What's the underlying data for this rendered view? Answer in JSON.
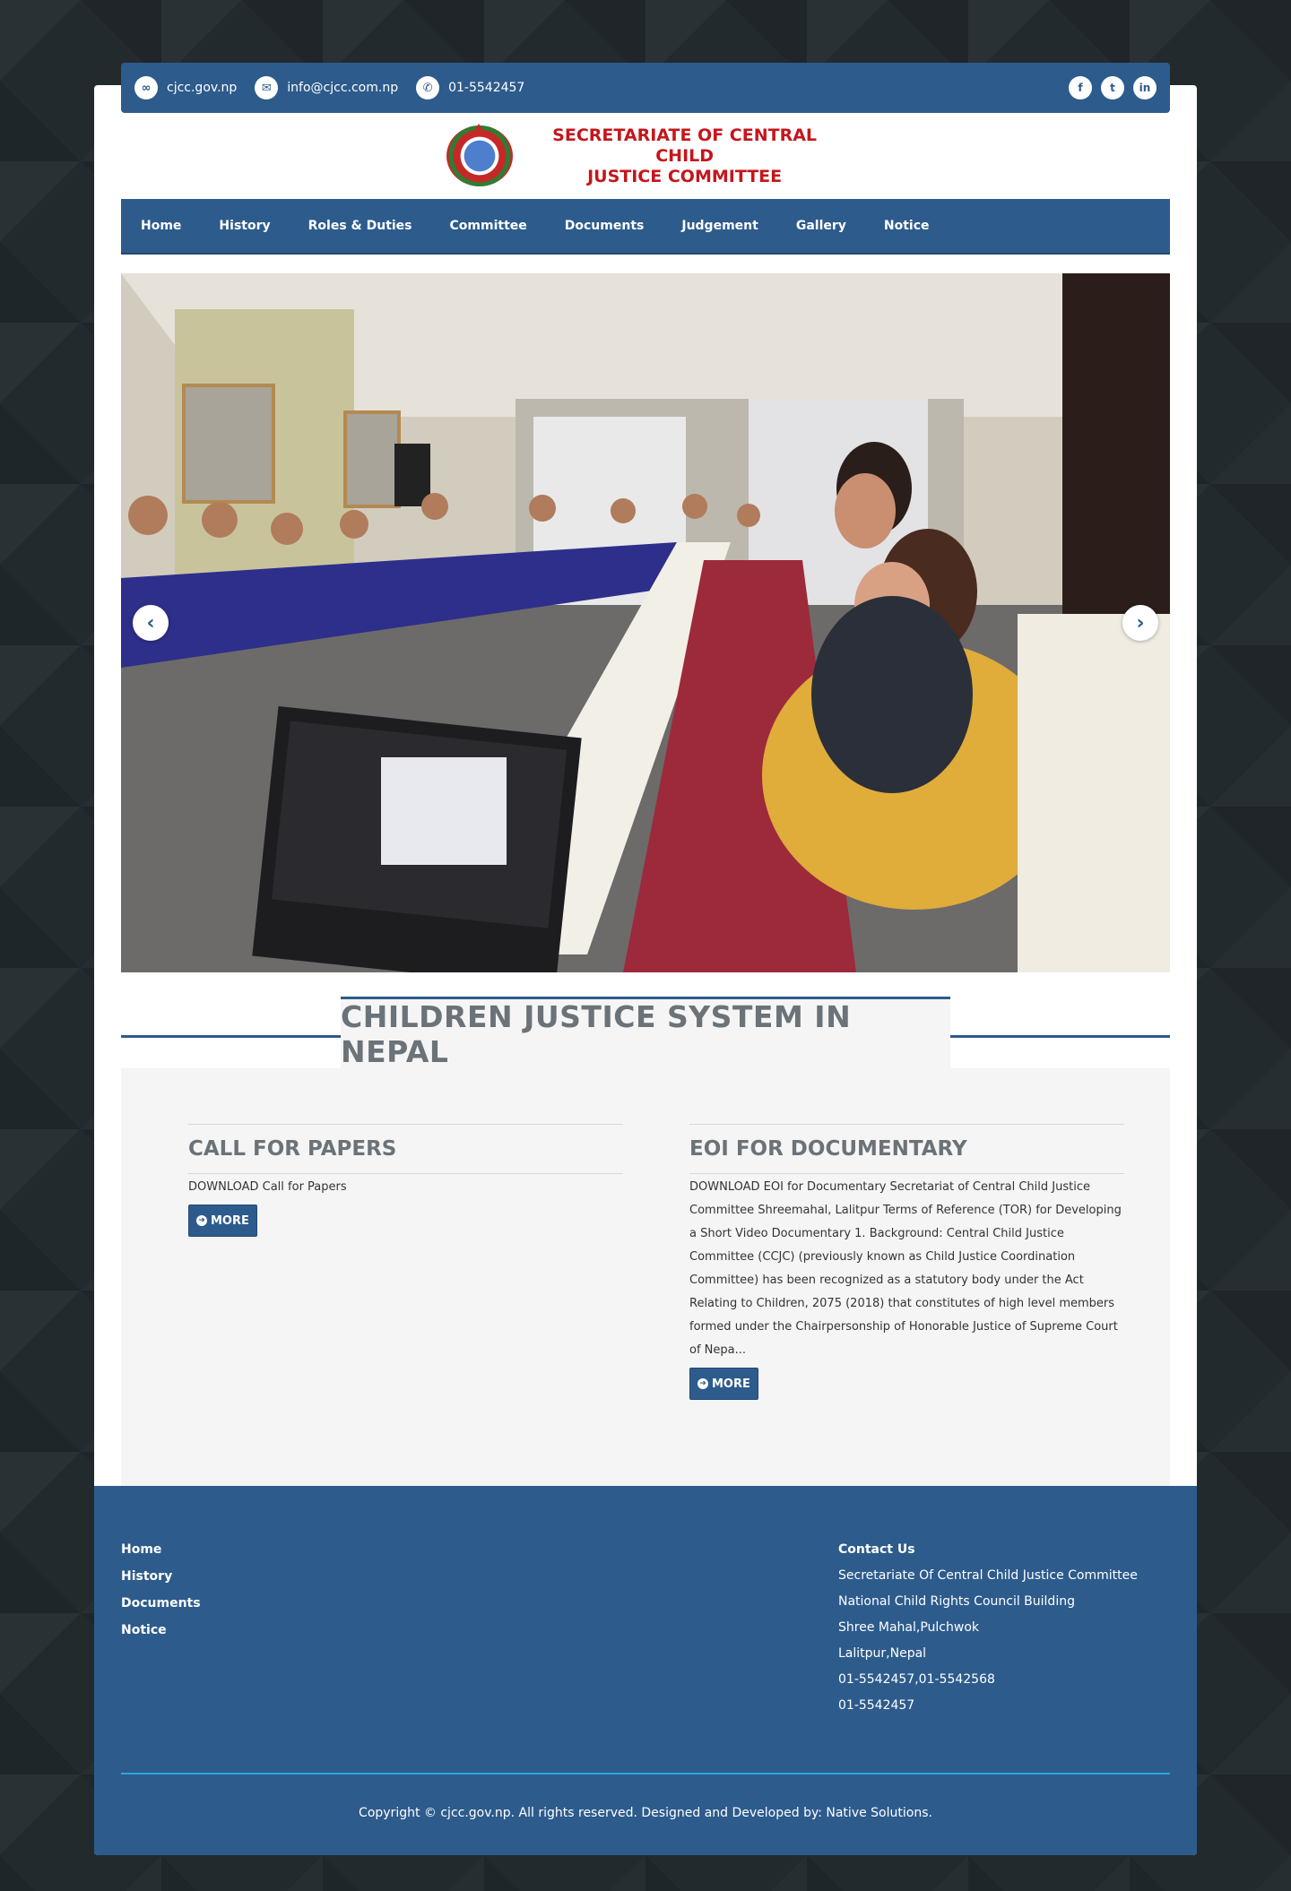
{
  "topbar": {
    "website": "cjcc.gov.np",
    "email": "info@cjcc.com.np",
    "phone": "01-5542457",
    "socials": [
      "facebook",
      "twitter",
      "linkedin"
    ]
  },
  "logo": {
    "line1": "SECRETARIATE OF CENTRAL CHILD",
    "line2": "JUSTICE COMMITTEE"
  },
  "nav": {
    "items": [
      "Home",
      "History",
      "Roles & Duties",
      "Committee",
      "Documents",
      "Judgement",
      "Gallery",
      "Notice"
    ]
  },
  "slider": {
    "prev_icon": "chevron-left-icon",
    "next_icon": "chevron-right-icon"
  },
  "section": {
    "title": "CHILDREN JUSTICE SYSTEM IN NEPAL"
  },
  "news": [
    {
      "title": "CALL FOR PAPERS",
      "body": "DOWNLOAD Call for Papers",
      "more": "MORE"
    },
    {
      "title": "EOI FOR DOCUMENTARY",
      "body": "DOWNLOAD EOI for Documentary Secretariat of Central Child Justice Committee Shreemahal, Lalitpur Terms of Reference (TOR) for Developing a Short Video Documentary 1. Background: Central Child Justice Committee (CCJC) (previously known as Child Justice Coordination Committee) has been recognized as a statutory body under the Act Relating to Children, 2075 (2018) that constitutes of high level members formed under the Chairpersonship of Honorable Justice of Supreme Court of Nepa...",
      "more": "MORE"
    }
  ],
  "footer": {
    "links": [
      "Home",
      "History",
      "Documents",
      "Notice"
    ],
    "contact_title": "Contact Us",
    "contact_lines": [
      "Secretariate Of Central Child Justice Committee",
      "National Child Rights Council Building",
      "Shree Mahal,Pulchwok",
      "Lalitpur,Nepal",
      "01-5542457,01-5542568",
      "01-5542457"
    ],
    "copyright": "Copyright © cjcc.gov.np. All rights reserved. Designed and Developed by: Native Solutions."
  }
}
